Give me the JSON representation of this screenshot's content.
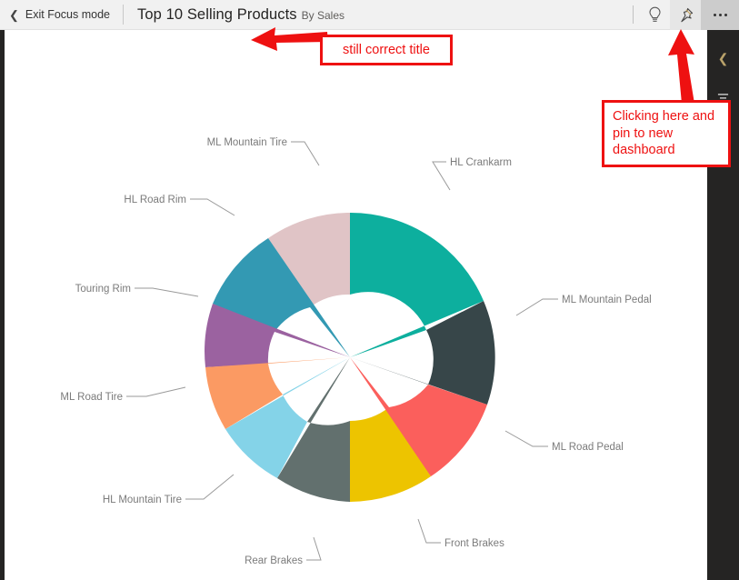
{
  "toolbar": {
    "exit_focus_label": "Exit Focus mode",
    "back_chevron_icon": "chevron-left-icon",
    "title": "Top 10 Selling Products",
    "subtitle": "By Sales",
    "insights_icon": "lightbulb-icon",
    "pin_icon": "pin-icon",
    "more_icon": "ellipsis-icon"
  },
  "right_panel": {
    "collapse_icon": "chevron-left-icon",
    "filter_icon": "filter-icon"
  },
  "annotations": {
    "title_note": "still correct title",
    "pin_note": "Clicking here and pin to new dashboard"
  },
  "chart_data": {
    "type": "pie",
    "title": "Top 10 Selling Products",
    "subtitle": "By Sales",
    "donut": true,
    "hole_ratio": 0.62,
    "legend": "none",
    "labels_position": "outside-with-leader-lines",
    "categories": [
      "HL Crankarm",
      "ML Mountain Pedal",
      "ML Road Pedal",
      "Front Brakes",
      "Rear Brakes",
      "HL Mountain Tire",
      "ML Road Tire",
      "Touring Rim",
      "HL Road Rim",
      "ML Mountain Tire"
    ],
    "values": [
      15.5,
      12.0,
      10.0,
      9.5,
      10.0,
      9.5,
      8.5,
      8.0,
      8.5,
      8.5
    ],
    "colors": [
      "#0DAF9E",
      "#374649",
      "#FB5F5C",
      "#EDC400",
      "#62706E",
      "#84D3E8",
      "#FB9A63",
      "#9B62A0",
      "#3399B3",
      "#E0C4C6"
    ],
    "start_angle_deg": 0
  }
}
